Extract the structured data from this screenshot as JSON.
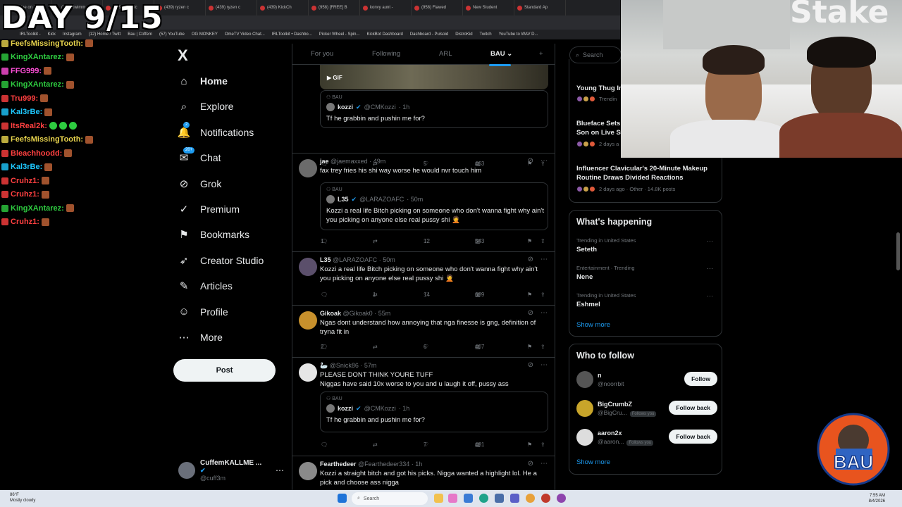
{
  "browser": {
    "tabs": [
      "(438) jae on X",
      "(958) swimm",
      "(439) Algovic",
      "(439) ryzen c",
      "(439) ryzen c",
      "(439) KickCh",
      "(958) [FREE] B",
      "konvy aunt -",
      "(958) Flawed",
      "New Student",
      "Standard Ap"
    ],
    "bookmarks": [
      "IRLToolkit -",
      "Kick",
      "Instagram",
      "(12) Home / Twitt",
      "Bau | Coffem",
      "(57) YouTube",
      "OG MONKEY",
      "OmeTV Video Chat...",
      "IRLToolkit • Dashbo...",
      "Picker Wheel - Spin...",
      "KickBot Dashboard",
      "Dashboard - Pulsoid",
      "DistroKid",
      "Twitch",
      "YouTube to WAV D..."
    ]
  },
  "overlay": {
    "day_title": "DAY 9/15",
    "chat": [
      {
        "user": "FeefsMissingTooth:",
        "color": "#e8d44d",
        "emotes": [
          "brown"
        ]
      },
      {
        "user": "KingXAntarez:",
        "color": "#2ecc40",
        "emotes": [
          "brown"
        ]
      },
      {
        "user": "FFG999:",
        "color": "#ff4fd8",
        "emotes": [
          "brown"
        ]
      },
      {
        "user": "KingXAntarez:",
        "color": "#2ecc40",
        "emotes": [
          "brown"
        ]
      },
      {
        "user": "Tru999:",
        "color": "#ff4040",
        "emotes": [
          "brown"
        ]
      },
      {
        "user": "Kal3rBe:",
        "color": "#1ec8ff",
        "emotes": [
          "brown"
        ]
      },
      {
        "user": "ItsReal2k:",
        "color": "#ff4040",
        "emotes": [
          "green",
          "green",
          "green"
        ]
      },
      {
        "user": "FeefsMissingTooth:",
        "color": "#e8d44d",
        "emotes": [
          "brown"
        ]
      },
      {
        "user": "Bleachhoodd:",
        "color": "#ff4040",
        "emotes": [
          "brown"
        ]
      },
      {
        "user": "Kal3rBe:",
        "color": "#1ec8ff",
        "emotes": [
          "brown"
        ]
      },
      {
        "user": "Cruhz1:",
        "color": "#ff4040",
        "emotes": [
          "brown"
        ]
      },
      {
        "user": "Cruhz1:",
        "color": "#ff4040",
        "emotes": [
          "brown"
        ]
      },
      {
        "user": "KingXAntarez:",
        "color": "#2ecc40",
        "emotes": [
          "brown"
        ]
      },
      {
        "user": "Cruhz1:",
        "color": "#ff4040",
        "emotes": [
          "brown"
        ]
      }
    ]
  },
  "nav": {
    "logo": "X",
    "items": [
      {
        "label": "Home",
        "icon": "home-icon",
        "glyph": "⌂",
        "active": true
      },
      {
        "label": "Explore",
        "icon": "search-icon",
        "glyph": "⌕"
      },
      {
        "label": "Notifications",
        "icon": "bell-icon",
        "glyph": "🔔",
        "badge": "2"
      },
      {
        "label": "Chat",
        "icon": "chat-icon",
        "glyph": "✉",
        "badge": "20+"
      },
      {
        "label": "Grok",
        "icon": "grok-icon",
        "glyph": "⊘"
      },
      {
        "label": "Premium",
        "icon": "premium-icon",
        "glyph": "✓"
      },
      {
        "label": "Bookmarks",
        "icon": "bookmark-icon",
        "glyph": "⚑"
      },
      {
        "label": "Creator Studio",
        "icon": "rocket-icon",
        "glyph": "➶"
      },
      {
        "label": "Articles",
        "icon": "articles-icon",
        "glyph": "✎"
      },
      {
        "label": "Profile",
        "icon": "person-icon",
        "glyph": "☺"
      },
      {
        "label": "More",
        "icon": "more-icon",
        "glyph": "⋯"
      }
    ],
    "post_label": "Post",
    "account": {
      "name": "CuffemKALLME ...",
      "handle": "@cuff3m"
    }
  },
  "timeline": {
    "tabs": [
      "For you",
      "Following",
      "ARL",
      "BAU ⌄",
      "+"
    ],
    "active_tab": 3,
    "gif_label": "GIF",
    "tweets": [
      {
        "kind": "quote-only",
        "quote": {
          "tag": "BAU",
          "name": "kozzi",
          "handle": "@CMKozzi",
          "time": "· 1h",
          "text": "Tf he grabbin and pushin me for?"
        },
        "stats": {
          "replies": "",
          "retweets": "",
          "likes": "5",
          "views": "463"
        }
      },
      {
        "name": "jae",
        "handle": "@jaemaxxed",
        "time": "· 49m",
        "text": "fax trey fries his shi way worse he would nvr touch him",
        "quote": {
          "tag": "BAU",
          "name": "L35",
          "handle": "@LARAZOAFC",
          "time": "· 50m",
          "text": "Kozzi a real life Bitch picking on someone who don't wanna fight why ain't you picking on anyone else real pussy shi 🤦"
        },
        "stats": {
          "replies": "1",
          "retweets": "",
          "likes": "12",
          "views": "543"
        }
      },
      {
        "name": "L35",
        "handle": "@LARAZOAFC",
        "time": "· 50m",
        "text": "Kozzi a real life Bitch picking on someone who don't wanna fight why ain't you picking on anyone else real pussy shi 🤦",
        "stats": {
          "replies": "",
          "retweets": "1",
          "likes": "14",
          "views": "689"
        }
      },
      {
        "name": "Gikoak",
        "handle": "@Gikoak0",
        "time": "· 55m",
        "text": "Ngas dont understand how annoying that nga finesse is gng, definition of tryna fit in",
        "stats": {
          "replies": "2",
          "retweets": "",
          "likes": "6",
          "views": "407"
        }
      },
      {
        "name": "🦢",
        "handle": "@Snick86",
        "time": "· 57m",
        "text": "PLEASE DONT THINK YOURE TUFF\nNiggas have said 10x worse to you and u laugh it off, pussy ass",
        "quote": {
          "tag": "BAU",
          "name": "kozzi",
          "handle": "@CMKozzi",
          "time": "· 1h",
          "text": "Tf he grabbin and pushin me for?"
        },
        "stats": {
          "replies": "",
          "retweets": "",
          "likes": "7",
          "views": "481"
        }
      },
      {
        "name": "Fearthedeer",
        "handle": "@Fearthedeer334",
        "time": "· 1h",
        "text": "Kozzi a straight bitch and got his picks. Nigga wanted a highlight lol. He a pick and choose ass nigga"
      }
    ]
  },
  "right": {
    "search_placeholder": "Search",
    "news": [
      {
        "title": "Young Thug In",
        "meta": "Trendin"
      },
      {
        "title": "Blueface Sets\nSon on Live St",
        "meta": "2 days a"
      },
      {
        "title": "Influencer Clavicular's 20-Minute Makeup Routine Draws Divided Reactions",
        "meta": "2 days ago · Other · 14.8K posts"
      }
    ],
    "happening_title": "What's happening",
    "trends": [
      {
        "meta": "Trending in United States",
        "name": "Seteth"
      },
      {
        "meta": "Entertainment · Trending",
        "name": "Nene"
      },
      {
        "meta": "Trending in United States",
        "name": "Eshmel"
      }
    ],
    "show_more": "Show more",
    "wtf_title": "Who to follow",
    "follow": [
      {
        "name": "n",
        "handle": "@noorrbit",
        "follows_you": false,
        "button": "Follow"
      },
      {
        "name": "BigCrumbZ",
        "handle": "@BigCru...",
        "follows_you": true,
        "button": "Follow back"
      },
      {
        "name": "aaron2x",
        "handle": "@aaron...",
        "follows_you": true,
        "button": "Follow back"
      }
    ],
    "follows_you_label": "Follows you"
  },
  "webcam": {
    "brand_text": "Stake"
  },
  "logo_text": "BAU",
  "taskbar": {
    "weather_temp": "86°F",
    "weather_desc": "Mostly cloudy",
    "search": "Search",
    "time": "7:55 AM",
    "date": "8/4/2026"
  }
}
